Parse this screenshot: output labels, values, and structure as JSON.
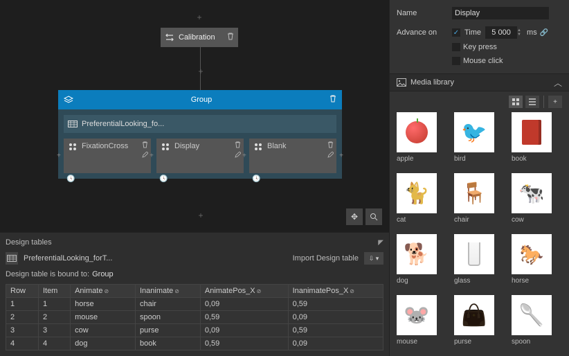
{
  "canvas": {
    "calibration_label": "Calibration",
    "group_label": "Group",
    "ref_label": "PreferentialLooking_fo...",
    "steps": [
      {
        "label": "FixationCross"
      },
      {
        "label": "Display"
      },
      {
        "label": "Blank"
      }
    ]
  },
  "design_tables": {
    "panel_title": "Design tables",
    "table_name": "PreferentialLooking_forT...",
    "import_label": "Import Design table",
    "bound_label": "Design table is bound to:",
    "bound_value": "Group",
    "columns": [
      "Row",
      "Item",
      "Animate",
      "Inanimate",
      "AnimatePos_X",
      "InanimatePos_X"
    ],
    "rows": [
      {
        "row": "1",
        "item": "1",
        "animate": "horse",
        "inanimate": "chair",
        "apos": "0,09",
        "ipos": "0,59"
      },
      {
        "row": "2",
        "item": "2",
        "animate": "mouse",
        "inanimate": "spoon",
        "apos": "0,59",
        "ipos": "0,09"
      },
      {
        "row": "3",
        "item": "3",
        "animate": "cow",
        "inanimate": "purse",
        "apos": "0,09",
        "ipos": "0,59"
      },
      {
        "row": "4",
        "item": "4",
        "animate": "dog",
        "inanimate": "book",
        "apos": "0,59",
        "ipos": "0,09"
      }
    ]
  },
  "properties": {
    "name_label": "Name",
    "name_value": "Display",
    "advance_label": "Advance on",
    "time_label": "Time",
    "time_value": "5 000",
    "time_unit": "ms",
    "keypress_label": "Key press",
    "mouseclick_label": "Mouse click"
  },
  "media_library": {
    "title": "Media library",
    "items": [
      {
        "id": "apple",
        "label": "apple"
      },
      {
        "id": "bird",
        "label": "bird"
      },
      {
        "id": "book",
        "label": "book"
      },
      {
        "id": "cat",
        "label": "cat"
      },
      {
        "id": "chair",
        "label": "chair"
      },
      {
        "id": "cow",
        "label": "cow"
      },
      {
        "id": "dog",
        "label": "dog"
      },
      {
        "id": "glass",
        "label": "glass"
      },
      {
        "id": "horse",
        "label": "horse"
      },
      {
        "id": "mouse",
        "label": "mouse"
      },
      {
        "id": "purse",
        "label": "purse"
      },
      {
        "id": "spoon",
        "label": "spoon"
      }
    ]
  }
}
